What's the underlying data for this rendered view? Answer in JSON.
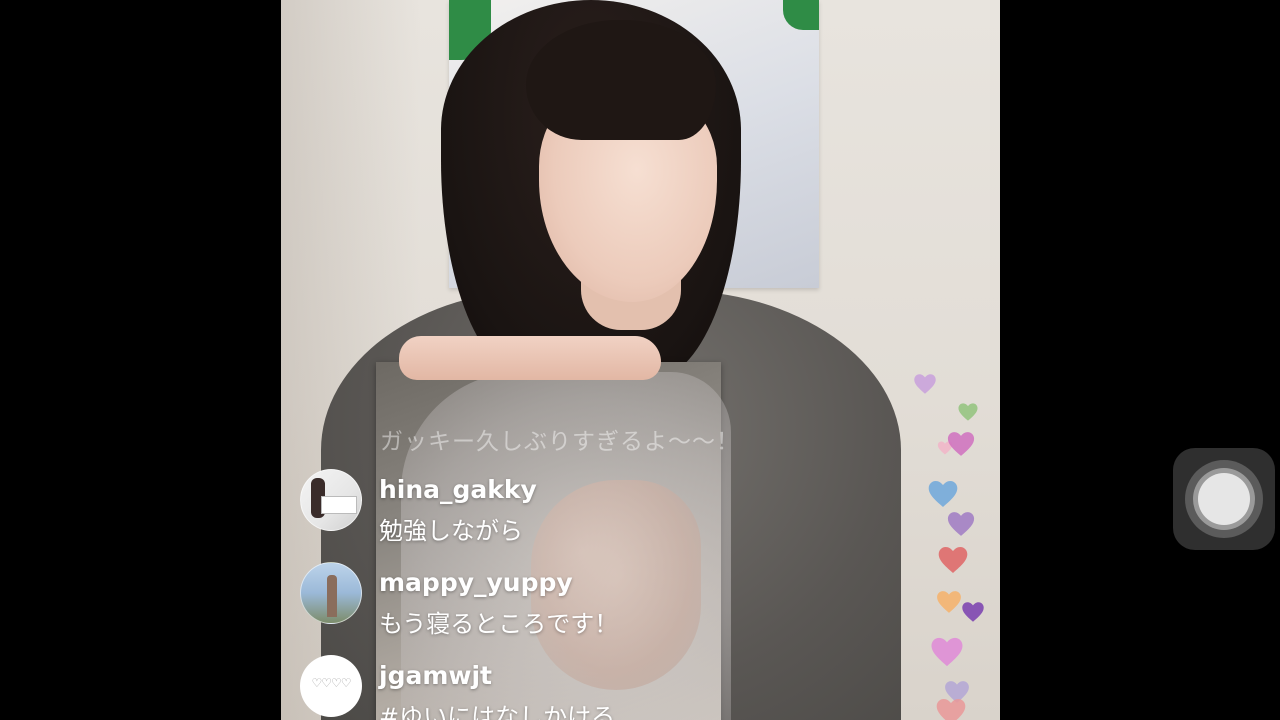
{
  "live": {
    "fading_comment": "ガッキー久しぶりすぎるよ〜〜！",
    "comments": [
      {
        "username": "hina_gakky",
        "message": "勉強しながら",
        "avatar_icon": "profile-photo-card-icon"
      },
      {
        "username": "mappy_yuppy",
        "message": "もう寝るところです！",
        "avatar_icon": "profile-photo-tower-icon"
      },
      {
        "username": "jgamwjt",
        "message": "#ゆいにはなしかける",
        "avatar_icon": "profile-photo-hearts-icon"
      }
    ],
    "heart_colors": [
      "#c9a0dc",
      "#f2b6c9",
      "#d070c0",
      "#6fa8dc",
      "#a07cc5",
      "#e06666",
      "#f6b26b",
      "#e08ad8",
      "#b4a7d6",
      "#ea9999",
      "#93c47d",
      "#7a3fb0"
    ]
  },
  "assistive_touch": {
    "icon": "assistive-touch-icon"
  }
}
